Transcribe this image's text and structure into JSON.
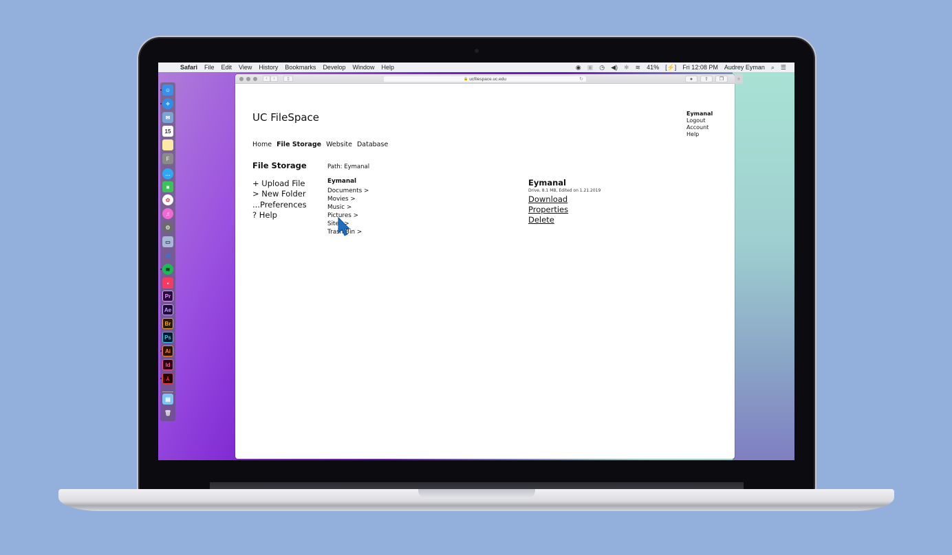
{
  "menubar": {
    "app": "Safari",
    "menus": [
      "File",
      "Edit",
      "View",
      "History",
      "Bookmarks",
      "Develop",
      "Window",
      "Help"
    ],
    "battery": "41%",
    "clock": "Fri 12:08 PM",
    "user": "Audrey Eyman"
  },
  "browser": {
    "url": "ucfilespace.uc.edu"
  },
  "site": {
    "title": "UC FileSpace",
    "account": {
      "username": "Eymanal",
      "logout": "Logout",
      "account": "Account",
      "help": "Help"
    },
    "nav": [
      "Home",
      "File Storage",
      "Website",
      "Database"
    ],
    "nav_active": "File Storage"
  },
  "storage": {
    "section_title": "File Storage",
    "actions": [
      "+ Upload File",
      "> New Folder",
      "...Preferences",
      "? Help"
    ],
    "path": "Path: Eymanal",
    "folder_title": "Eymanal",
    "folders": [
      "Documents >",
      "Movies >",
      "Music >",
      "Pictures >",
      "Sites >",
      "Trash Bin >"
    ]
  },
  "details": {
    "name": "Eymanal",
    "meta": "Drive, 8.1 MB, Edited on 1.21.2019",
    "links": [
      "Download",
      "Properties",
      "Delete"
    ]
  },
  "dock": {
    "apps": [
      {
        "name": "finder",
        "label": "☺",
        "bg": "#3b8fe8",
        "fg": "#fff"
      },
      {
        "name": "safari",
        "label": "✧",
        "bg": "#2f8ee8",
        "fg": "#fff"
      },
      {
        "name": "mail",
        "label": "✉",
        "bg": "#7aa3d6",
        "fg": "#fff"
      },
      {
        "name": "calendar",
        "label": "15",
        "bg": "#ffffff",
        "fg": "#333"
      },
      {
        "name": "notes",
        "label": "",
        "bg": "#fbe9a6",
        "fg": "#333"
      },
      {
        "name": "fontbook",
        "label": "F",
        "bg": "#8a8a8a",
        "fg": "#ddd"
      },
      {
        "name": "messages",
        "label": "…",
        "bg": "#2ea7f5",
        "fg": "#fff"
      },
      {
        "name": "facetime",
        "label": "■",
        "bg": "#3bc35a",
        "fg": "#fff"
      },
      {
        "name": "photos",
        "label": "✿",
        "bg": "#ffffff",
        "fg": "#e55"
      },
      {
        "name": "itunes",
        "label": "♫",
        "bg": "#f06ad0",
        "fg": "#fff"
      },
      {
        "name": "system-preferences",
        "label": "⚙",
        "bg": "#6b6b6b",
        "fg": "#ddd"
      },
      {
        "name": "preview",
        "label": "▭",
        "bg": "#a7b9d6",
        "fg": "#335"
      },
      {
        "name": "word",
        "label": "W",
        "bg": "transparent",
        "fg": "#2a7ae2"
      },
      {
        "name": "spotify",
        "label": "≋",
        "bg": "#1db954",
        "fg": "#111"
      },
      {
        "name": "screens",
        "label": "▪",
        "bg": "#f53b64",
        "fg": "#fff"
      },
      {
        "name": "premiere",
        "label": "Pr",
        "bg": "#2a0a3a",
        "fg": "#e39cff"
      },
      {
        "name": "after-effects",
        "label": "Ae",
        "bg": "#1f0a3a",
        "fg": "#c9a0ff"
      },
      {
        "name": "bridge",
        "label": "Br",
        "bg": "#2a1a00",
        "fg": "#f0a830"
      },
      {
        "name": "photoshop",
        "label": "Ps",
        "bg": "#001c2a",
        "fg": "#31c5f0"
      },
      {
        "name": "illustrator",
        "label": "Ai",
        "bg": "#2a1200",
        "fg": "#ff8a1f"
      },
      {
        "name": "indesign",
        "label": "Id",
        "bg": "#2a0012",
        "fg": "#ff4f8f"
      },
      {
        "name": "acrobat",
        "label": "⅄",
        "bg": "#2a0000",
        "fg": "#ff3b30"
      },
      {
        "name": "downloads",
        "label": "▤",
        "bg": "#7fc4ee",
        "fg": "#fff"
      },
      {
        "name": "trash",
        "label": "🗑",
        "bg": "transparent",
        "fg": "#ddd"
      }
    ]
  }
}
